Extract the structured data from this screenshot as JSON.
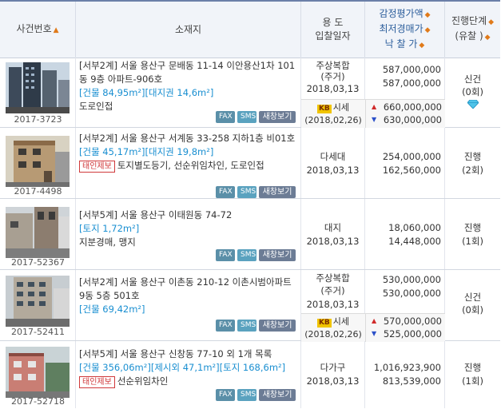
{
  "header": {
    "case_no": "사건번호",
    "location": "소재지",
    "usage": "용 도",
    "bid_date": "입찰일자",
    "appraisal": "감정평가액",
    "min_price": "최저경매가",
    "winning_bid": "낙 찰 가",
    "progress": "진행단계",
    "fail_count": "(유찰 )",
    "sort_icon": "sort-arrows-icon"
  },
  "buttons": {
    "fax": "FAX",
    "sms": "SMS",
    "new_window": "새창보기"
  },
  "market_label": "시세",
  "rows": [
    {
      "case_no": "2017-3723",
      "address": "[서부2계] 서울 용산구 문배동 11-14 이안용산1차 101동 9층 아파트-906호",
      "area": "[건물 84,95m²][대지권 14,6m²]",
      "note": "도로인접",
      "usage_1": "주상복합",
      "usage_2": "(주거)",
      "date": "2018,03,13",
      "appraisal": "587,000,000",
      "min_price": "587,000,000",
      "status": "신건",
      "fail": "(0회)",
      "market_date": "(2018,02,26)",
      "market_high": "660,000,000",
      "market_low": "630,000,000"
    },
    {
      "case_no": "2017-4498",
      "address": "[서부2계] 서울 용산구 서계동 33-258 지하1층 비01호",
      "area": "[건물 45,17m²][대지권 19,8m²]",
      "tag": "태인제보",
      "note": "토지별도등기, 선순위임차인, 도로인접",
      "usage_1": "다세대",
      "date": "2018,03,13",
      "appraisal": "254,000,000",
      "min_price": "162,560,000",
      "status": "진행",
      "fail": "(2회)"
    },
    {
      "case_no": "2017-52367",
      "address": "[서부5계] 서울 용산구 이태원동 74-72",
      "area": "[토지 1,72m²]",
      "note": "지분경매, 맹지",
      "usage_1": "대지",
      "date": "2018,03,13",
      "appraisal": "18,060,000",
      "min_price": "14,448,000",
      "status": "진행",
      "fail": "(1회)"
    },
    {
      "case_no": "2017-52411",
      "address": "[서부2계] 서울 용산구 이촌동 210-12 이촌시범아파트 9동 5층 501호",
      "area": "[건물 69,42m²]",
      "usage_1": "주상복합",
      "usage_2": "(주거)",
      "date": "2018,03,13",
      "appraisal": "530,000,000",
      "min_price": "530,000,000",
      "status": "신건",
      "fail": "(0회)",
      "market_date": "(2018,02,26)",
      "market_high": "570,000,000",
      "market_low": "525,000,000"
    },
    {
      "case_no": "2017-52718",
      "address": "[서부5계] 서울 용산구 신창동 77-10 외 1개 목록",
      "area": "[건물 356,06m²][제시외 47,1m²][토지 168,6m²]",
      "tag": "태인제보",
      "note": "선순위임차인",
      "usage_1": "다가구",
      "date": "2018,03,13",
      "appraisal": "1,016,923,900",
      "min_price": "813,539,000",
      "status": "진행",
      "fail": "(1회)"
    }
  ],
  "colors": {
    "accent": "#1a8fd1",
    "header_bg": "#f1f4f9",
    "sort": "#e07a1a",
    "tag": "#d0393b"
  }
}
